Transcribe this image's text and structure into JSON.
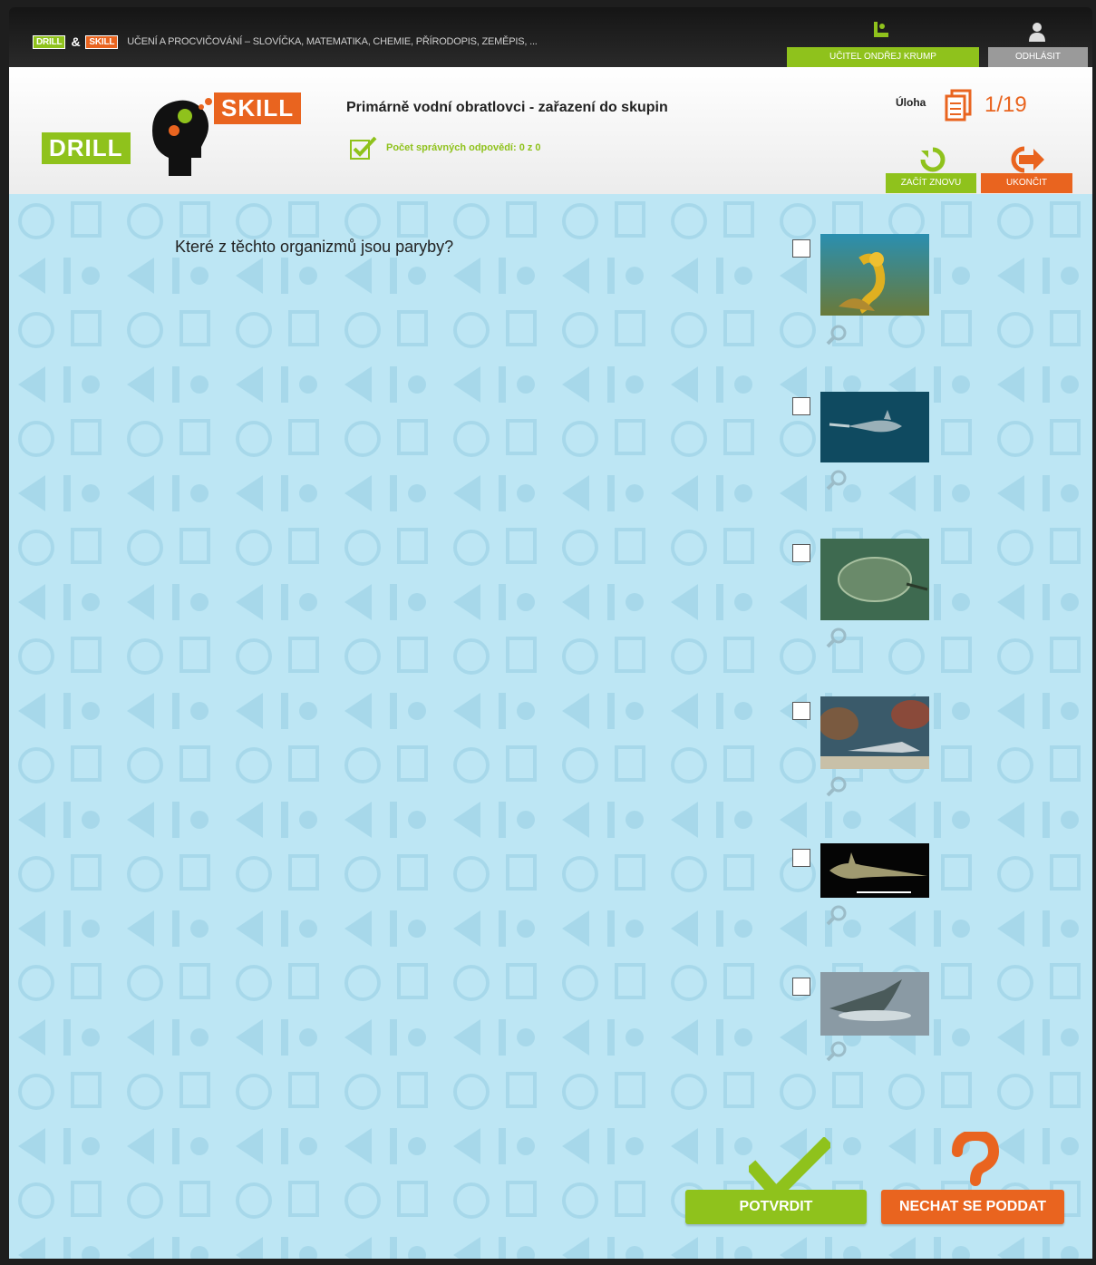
{
  "topbar": {
    "brand_drill": "DRILL",
    "brand_amp": "&",
    "brand_skill": "SKILL",
    "brand_text": "UČENÍ A PROCVIČOVÁNÍ – SLOVÍČKA, MATEMATIKA, CHEMIE, PŘÍRODOPIS, ZEMĚPIS, ...",
    "user_label": "UČITEL ONDŘEJ KRUMP",
    "logout_label": "ODHLÁSIT"
  },
  "header": {
    "logo_drill": "DRILL",
    "logo_skill": "SKILL",
    "task_title": "Primárně vodní obratlovci - zařazení do skupin",
    "correct_count": "Počet správných odpovědí: 0 z 0",
    "uloha_label": "Úloha",
    "uloha_count": "1/19",
    "restart_label": "ZAČÍT ZNOVU",
    "end_label": "UKONČIT"
  },
  "main": {
    "question": "Které z těchto organizmů jsou paryby?",
    "confirm_label": "POTVRDIT",
    "giveup_label": "NECHAT SE PODDAT"
  },
  "answers": [
    {
      "checked": false,
      "image": "seahorse-photo"
    },
    {
      "checked": false,
      "image": "sawfish-photo"
    },
    {
      "checked": false,
      "image": "flatfish-photo"
    },
    {
      "checked": false,
      "image": "shark-on-reef-photo"
    },
    {
      "checked": false,
      "image": "chimaera-photo"
    },
    {
      "checked": false,
      "image": "shark-surfacing-photo"
    }
  ],
  "colors": {
    "green": "#8fc21c",
    "orange": "#e9641f",
    "background": "#bde6f4"
  }
}
